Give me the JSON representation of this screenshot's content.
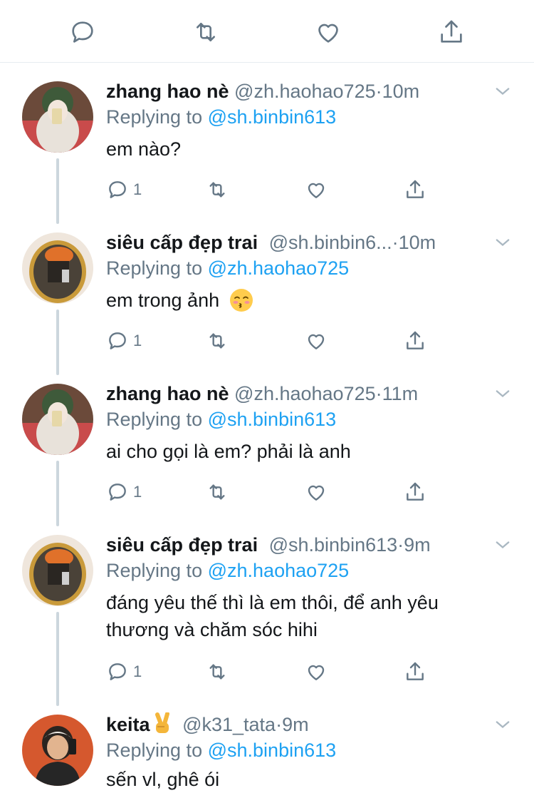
{
  "top_actions": [
    "reply-icon",
    "retweet-icon",
    "like-icon",
    "share-icon"
  ],
  "colors": {
    "link": "#1da1f2",
    "muted": "#657786",
    "text": "#14171a",
    "thread_line": "#ccd6dd"
  },
  "tweets": [
    {
      "name": "zhang hao nè",
      "handle": "@zh.haohao725",
      "dot": "·",
      "time": "10m",
      "replying_prefix": "Replying to",
      "replying_to": "@sh.binbin613",
      "text": "em nào?",
      "reply_count": "1"
    },
    {
      "name": "siêu cấp đẹp trai",
      "handle": "@sh.binbin6...",
      "dot": "·",
      "time": "10m",
      "replying_prefix": "Replying to",
      "replying_to": "@zh.haohao725",
      "text": "em trong ảnh",
      "emoji": "kissing-face-closed-eyes",
      "reply_count": "1"
    },
    {
      "name": "zhang hao nè",
      "handle": "@zh.haohao725",
      "dot": "·",
      "time": "11m",
      "replying_prefix": "Replying to",
      "replying_to": "@sh.binbin613",
      "text": "ai cho gọi là em? phải là anh",
      "reply_count": "1"
    },
    {
      "name": "siêu cấp đẹp trai",
      "handle": "@sh.binbin613",
      "dot": "·",
      "time": "9m",
      "replying_prefix": "Replying to",
      "replying_to": "@zh.haohao725",
      "text_line1": "đáng yêu thế thì là em thôi, để anh yêu",
      "text_line2": "thương và chăm sóc hihi",
      "reply_count": "1"
    },
    {
      "name": "keita",
      "name_emoji": "victory-hand",
      "handle": "@k31_tata",
      "dot": "·",
      "time": "9m",
      "replying_prefix": "Replying to",
      "replying_to": "@sh.binbin613",
      "text": "sến vl, ghê ói"
    }
  ]
}
